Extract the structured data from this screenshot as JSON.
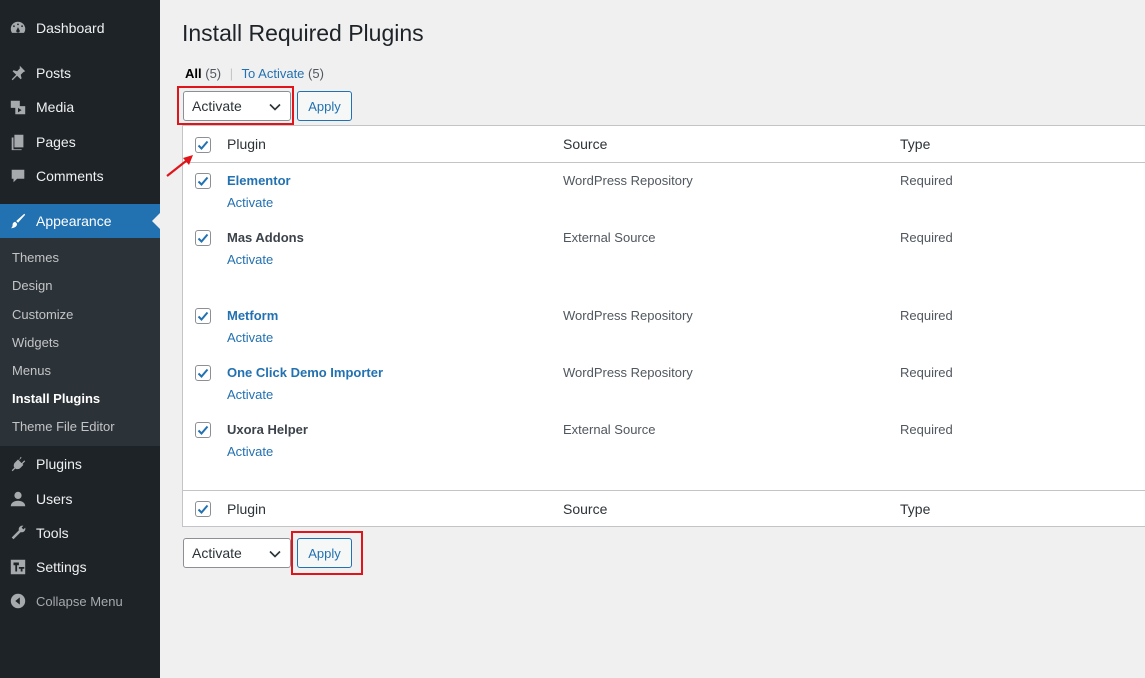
{
  "sidebar": {
    "items": [
      {
        "label": "Dashboard",
        "icon": "dashboard-icon"
      },
      {
        "label": "Posts",
        "icon": "pushpin-icon"
      },
      {
        "label": "Media",
        "icon": "media-icon"
      },
      {
        "label": "Pages",
        "icon": "pages-icon"
      },
      {
        "label": "Comments",
        "icon": "comment-icon"
      },
      {
        "label": "Appearance",
        "icon": "paintbrush-icon"
      },
      {
        "label": "Plugins",
        "icon": "plug-icon"
      },
      {
        "label": "Users",
        "icon": "users-icon"
      },
      {
        "label": "Tools",
        "icon": "wrench-icon"
      },
      {
        "label": "Settings",
        "icon": "settings-icon"
      },
      {
        "label": "Collapse Menu",
        "icon": "collapse-icon"
      }
    ],
    "submenu": [
      "Themes",
      "Design",
      "Customize",
      "Widgets",
      "Menus",
      "Install Plugins",
      "Theme File Editor"
    ],
    "current_submenu": "Install Plugins"
  },
  "page": {
    "title": "Install Required Plugins",
    "filters": {
      "all_label": "All",
      "all_count": "(5)",
      "separator": "|",
      "to_activate_label": "To Activate",
      "to_activate_count": "(5)"
    },
    "bulk_top": {
      "selected": "Activate",
      "apply": "Apply"
    },
    "bulk_bottom": {
      "selected": "Activate",
      "apply": "Apply"
    }
  },
  "table": {
    "columns": [
      "Plugin",
      "Source",
      "Type"
    ],
    "rows": [
      {
        "name": "Elementor",
        "action": "Activate",
        "source": "WordPress Repository",
        "type": "Required",
        "linked": true
      },
      {
        "name": "Mas Addons",
        "action": "Activate",
        "source": "External Source",
        "type": "Required",
        "linked": false
      },
      {
        "name": "Metform",
        "action": "Activate",
        "source": "WordPress Repository",
        "type": "Required",
        "linked": true
      },
      {
        "name": "One Click Demo Importer",
        "action": "Activate",
        "source": "WordPress Repository",
        "type": "Required",
        "linked": true
      },
      {
        "name": "Uxora Helper",
        "action": "Activate",
        "source": "External Source",
        "type": "Required",
        "linked": false
      }
    ]
  },
  "colors": {
    "sidebar_bg": "#1d2327",
    "accent": "#2271b1",
    "highlight_annotation": "#e0151b"
  }
}
